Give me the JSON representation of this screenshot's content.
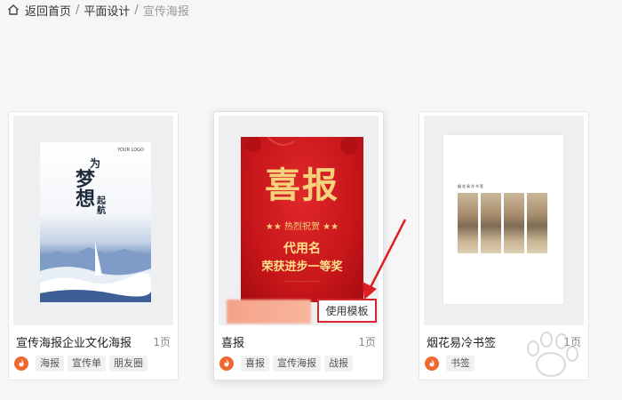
{
  "breadcrumb": {
    "home": "返回首页",
    "category": "平面设计",
    "current": "宣传海报"
  },
  "cards": [
    {
      "title": "宣传海报企业文化海报",
      "pages": "1页",
      "tags": [
        "海报",
        "宣传单",
        "朋友圈"
      ],
      "poster": {
        "logo": "YOUR LOGO",
        "char1": "为",
        "char2": "梦想",
        "char3": "起航"
      }
    },
    {
      "title": "喜报",
      "pages": "1页",
      "tags": [
        "喜报",
        "宣传海报",
        "战报"
      ],
      "poster": {
        "title": "喜报",
        "sub": "★★ 热烈祝贺 ★★",
        "name": "代用名",
        "award": "荣获进步一等奖"
      },
      "use_template_label": "使用模板"
    },
    {
      "title": "烟花易冷书签",
      "pages": "1页",
      "tags": [
        "书签"
      ],
      "poster": {
        "heading": "烟花易冷书签"
      }
    }
  ],
  "colors": {
    "accent_red": "#d8262c",
    "brand_orange": "#f0682f",
    "background": "#f6f6f7"
  },
  "icons": {
    "home": "home-icon",
    "brand": "flame-logo-icon",
    "arrow": "red-arrow-annotation"
  }
}
